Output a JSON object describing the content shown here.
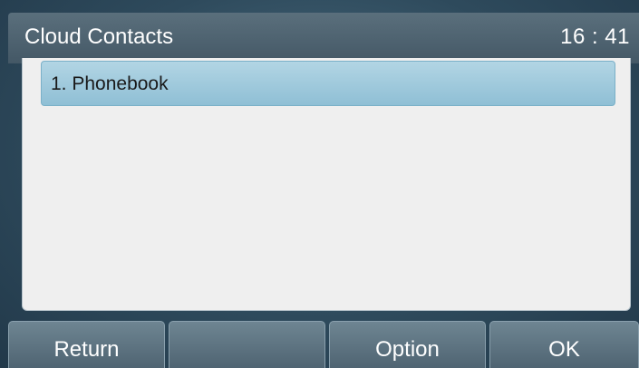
{
  "header": {
    "title": "Cloud Contacts",
    "time": "16 : 41"
  },
  "list": {
    "items": [
      {
        "label": "1. Phonebook",
        "selected": true
      }
    ]
  },
  "softkeys": [
    {
      "label": "Return"
    },
    {
      "label": ""
    },
    {
      "label": "Option"
    },
    {
      "label": "OK"
    }
  ],
  "colors": {
    "header_bg": "#4f6472",
    "selection_bg": "#a3cde0",
    "panel_bg": "#efefef"
  }
}
